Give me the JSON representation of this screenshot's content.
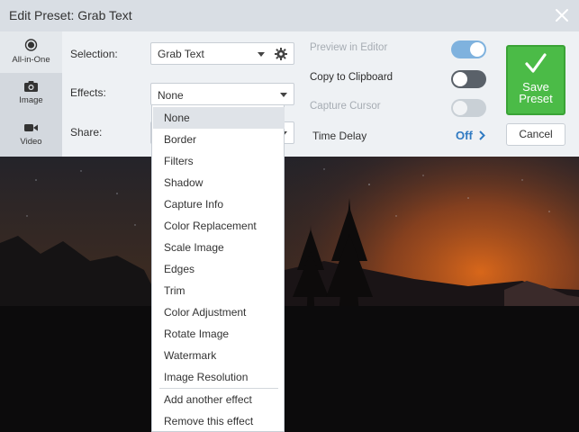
{
  "window": {
    "title": "Edit Preset: Grab Text",
    "close_icon": "close-icon"
  },
  "sidebar": {
    "items": [
      {
        "label": "All-in-One",
        "icon": "circle-icon",
        "active": true
      },
      {
        "label": "Image",
        "icon": "camera-icon",
        "active": false
      },
      {
        "label": "Video",
        "icon": "video-camera-icon",
        "active": false
      }
    ]
  },
  "form": {
    "selection": {
      "label": "Selection:",
      "value": "Grab Text"
    },
    "effects": {
      "label": "Effects:",
      "value": "None"
    },
    "share": {
      "label": "Share:"
    }
  },
  "options": {
    "preview_in_editor": {
      "label": "Preview in Editor",
      "state": "on",
      "enabled": false
    },
    "copy_to_clipboard": {
      "label": "Copy to Clipboard",
      "state": "off",
      "enabled": true
    },
    "capture_cursor": {
      "label": "Capture Cursor",
      "state": "off",
      "enabled": false
    }
  },
  "time_delay": {
    "label": "Time Delay",
    "value": "Off"
  },
  "buttons": {
    "save": [
      "Save",
      "Preset"
    ],
    "cancel": "Cancel"
  },
  "effects_menu": {
    "items": [
      "None",
      "Border",
      "Filters",
      "Shadow",
      "Capture Info",
      "Color Replacement",
      "Scale Image",
      "Edges",
      "Trim",
      "Color Adjustment",
      "Rotate Image",
      "Watermark",
      "Image Resolution"
    ],
    "selected": "None",
    "actions": [
      "Add another effect",
      "Remove this effect"
    ]
  },
  "colors": {
    "accent_green": "#4bbb47",
    "link_blue": "#2f7ac2",
    "toggle_on": "#7fb2de"
  }
}
